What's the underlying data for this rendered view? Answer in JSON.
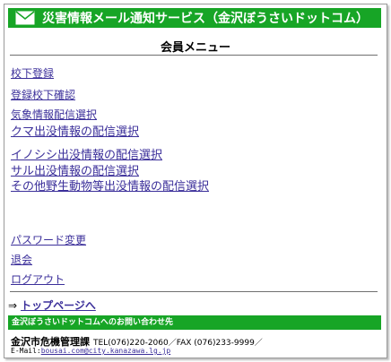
{
  "header": {
    "title": "災害情報メール通知サービス（金沢ぼうさいドットコム）",
    "icon": "envelope-icon",
    "color": "#17a526"
  },
  "page_title": "会員メニュー",
  "menu": [
    {
      "label": "校下登録"
    },
    {
      "label": "登録校下確認"
    },
    {
      "label": "気象情報配信選択"
    },
    {
      "label": "クマ出没情報の配信選択"
    },
    {
      "label": "イノシシ出没情報の配信選択"
    },
    {
      "label": "サル出没情報の配信選択"
    },
    {
      "label": "その他野生動物等出没情報の配信選択"
    }
  ],
  "account_menu": [
    {
      "label": "パスワード変更"
    },
    {
      "label": "退会"
    },
    {
      "label": "ログアウト"
    }
  ],
  "top_link": {
    "arrow": "⇒",
    "label": "トップページへ"
  },
  "footer": {
    "contact_title": "金沢ぼうさいドットコムへのお問い合わせ先",
    "org": "金沢市危機管理課",
    "tel_fax": "TEL(076)220-2060／FAX (076)233-9999／",
    "mail_prefix": "E-Mail:",
    "mail": "bousai.com@city.kanazawa.lg.jp"
  }
}
